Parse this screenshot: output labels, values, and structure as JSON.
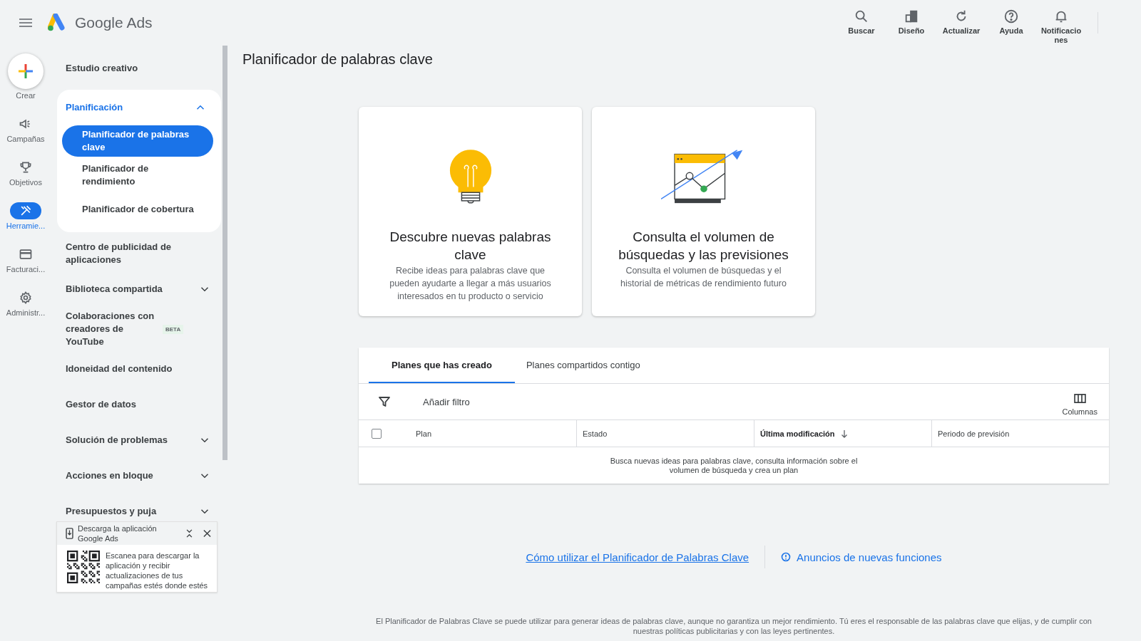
{
  "header": {
    "product": "Google Ads",
    "actions": [
      {
        "kind": "search",
        "label": "Buscar"
      },
      {
        "kind": "layout",
        "label": "Diseño"
      },
      {
        "kind": "refresh",
        "label": "Actualizar"
      },
      {
        "kind": "help",
        "label": "Ayuda"
      },
      {
        "kind": "bell",
        "label": "Notificaciones"
      }
    ]
  },
  "rail": {
    "create": "Crear",
    "items": [
      {
        "kind": "megaphone",
        "label": "Campañas",
        "selected": false
      },
      {
        "kind": "trophy",
        "label": "Objetivos",
        "selected": false
      },
      {
        "kind": "tools",
        "label": "Herramie...",
        "selected": true
      },
      {
        "kind": "card",
        "label": "Facturaci...",
        "selected": false
      },
      {
        "kind": "gear",
        "label": "Administr...",
        "selected": false
      }
    ]
  },
  "nav": [
    {
      "label": "Estudio creativo",
      "selected": false
    },
    {
      "label": "Planificación",
      "selected": true,
      "expanded": true,
      "children": [
        {
          "label": "Planificador de palabras clave",
          "selected": true
        },
        {
          "label": "Planificador de rendimiento",
          "selected": false
        },
        {
          "label": "Planificador de cobertura",
          "selected": false
        }
      ]
    },
    {
      "label": "Centro de publicidad de aplicaciones",
      "selected": false
    },
    {
      "label": "Biblioteca compartida",
      "selected": false,
      "expanded": false
    },
    {
      "label": "Colaboraciones con creadores de YouTube",
      "selected": false,
      "badge": "BETA"
    },
    {
      "label": "Idoneidad del contenido",
      "selected": false
    },
    {
      "label": "Gestor de datos",
      "selected": false
    },
    {
      "label": "Solución de problemas",
      "selected": false,
      "expanded": false
    },
    {
      "label": "Acciones en bloque",
      "selected": false,
      "expanded": false
    },
    {
      "label": "Presupuestos y puja",
      "selected": false,
      "expanded": false
    }
  ],
  "app_popup": {
    "title": "Descarga la aplicación Google Ads",
    "text": "Escanea para descargar la aplicación y recibir actualizaciones de tus campañas estés donde estés"
  },
  "page_title": "Planificador de palabras clave",
  "cards": [
    {
      "kind": "bulb",
      "title": "Descubre nuevas palabras clave",
      "text": "Recibe ideas para palabras clave que pueden ayudarte a llegar a más usuarios interesados en tu producto o servicio"
    },
    {
      "kind": "chart",
      "title": "Consulta el volumen de búsquedas y las previsiones",
      "text": "Consulta el volumen de búsquedas y el historial de métricas de rendimiento futuro"
    }
  ],
  "plans": {
    "tabs": [
      {
        "label": "Planes que has creado",
        "selected": true
      },
      {
        "label": "Planes compartidos contigo",
        "selected": false
      }
    ],
    "filter": "Añadir filtro",
    "columns_button": "Columnas",
    "select_all": {
      "checked": false
    },
    "columns": [
      {
        "label": "Plan",
        "sorted": false
      },
      {
        "label": "Estado",
        "sorted": false
      },
      {
        "label": "Última modificación",
        "sorted": true
      },
      {
        "label": "Periodo de previsión",
        "sorted": false
      }
    ],
    "empty_message": "Busca nuevas ideas para palabras clave, consulta información sobre el volumen de búsqueda y crea un plan"
  },
  "links": [
    {
      "kind": "plain",
      "label": "Cómo utilizar el Planificador de Palabras Clave"
    },
    {
      "kind": "info",
      "label": "Anuncios de nuevas funciones"
    }
  ],
  "disclaimer": "El Planificador de Palabras Clave se puede utilizar para generar ideas de palabras clave, aunque no garantiza un mejor rendimiento. Tú eres el responsable de las palabras clave que elijas, y de cumplir con nuestras políticas publicitarias y con las leyes pertinentes."
}
